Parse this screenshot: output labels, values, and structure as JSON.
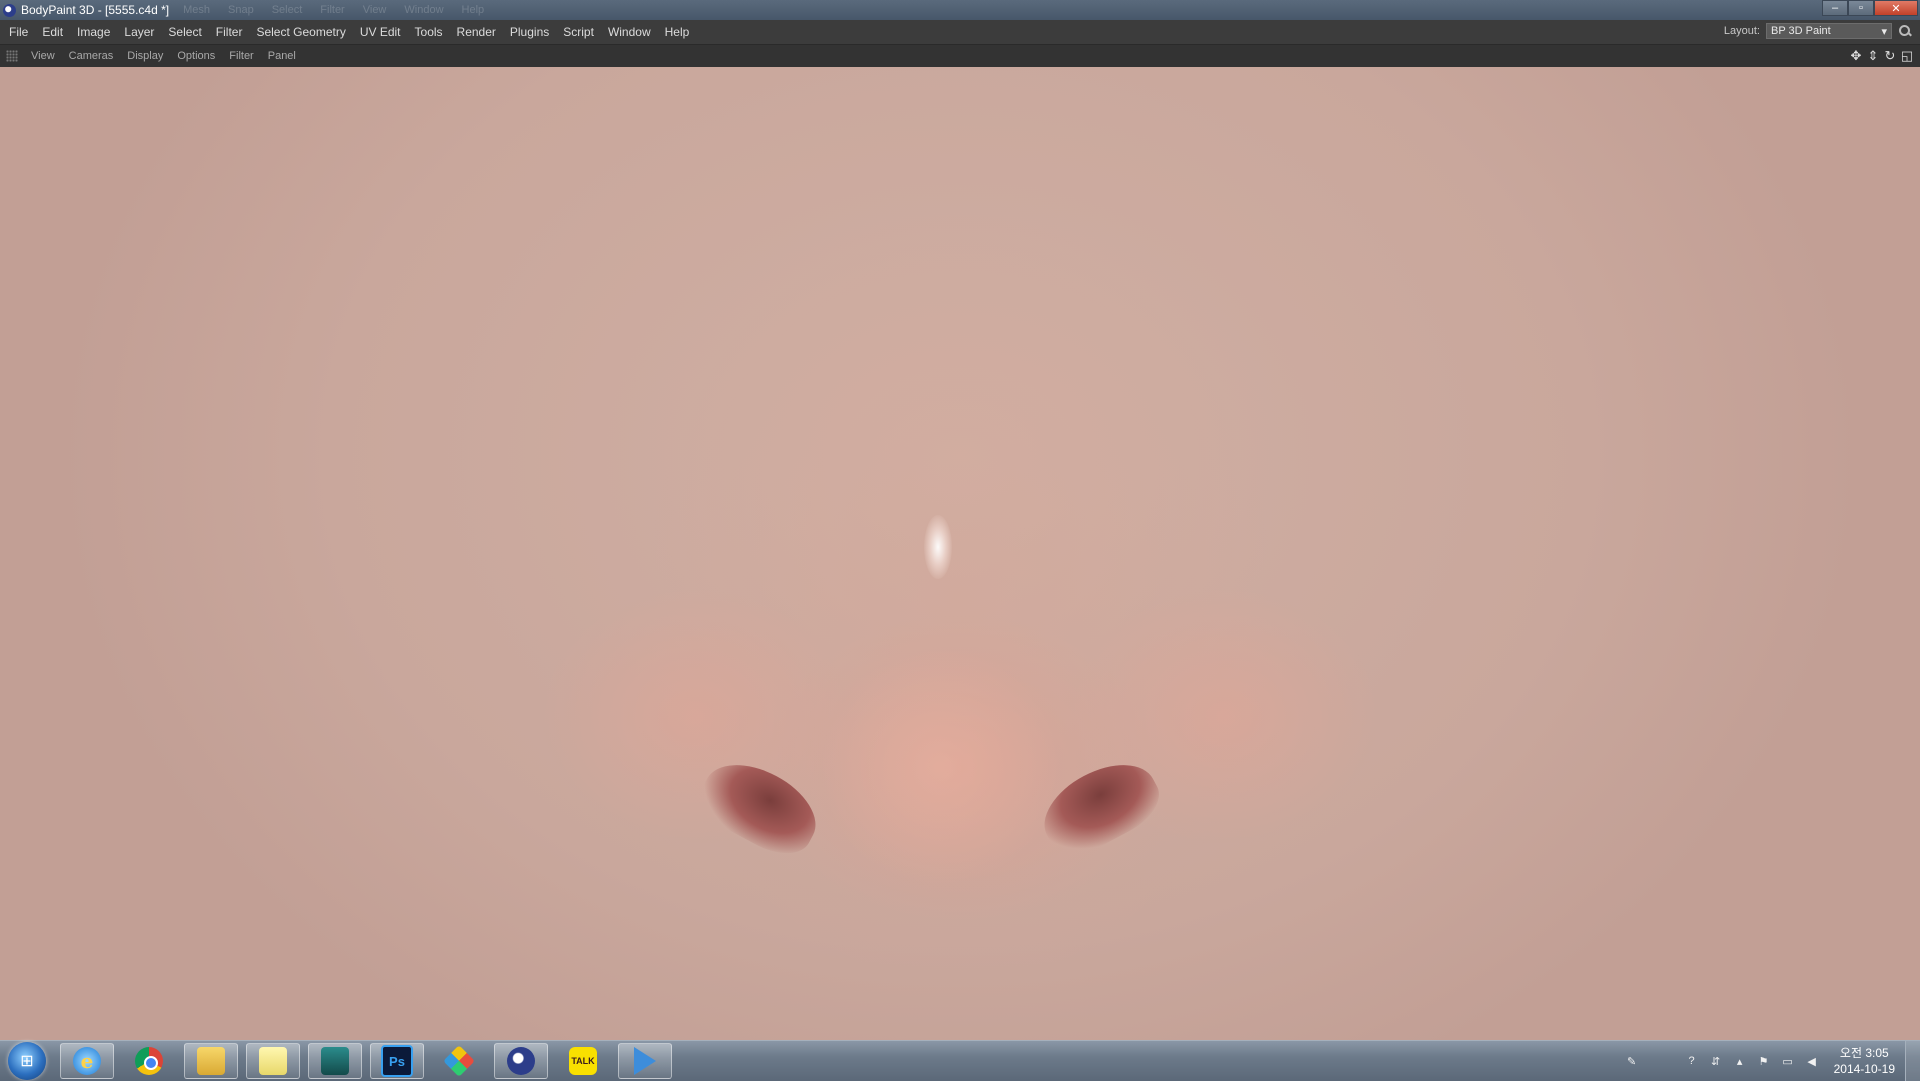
{
  "window": {
    "title": "BodyPaint 3D - [5555.c4d *]",
    "ghost_menu": [
      "Mesh",
      "Snap",
      "Select",
      "Filter",
      "View",
      "Window",
      "Help"
    ],
    "controls": {
      "minimize": "–",
      "maximize": "▫",
      "close": "✕"
    }
  },
  "menubar": {
    "items": [
      "File",
      "Edit",
      "Image",
      "Layer",
      "Select",
      "Filter",
      "Select Geometry",
      "UV Edit",
      "Tools",
      "Render",
      "Plugins",
      "Script",
      "Window",
      "Help"
    ],
    "layout_label": "Layout:",
    "layout_value": "BP 3D Paint"
  },
  "viewport_bar": {
    "items": [
      "View",
      "Cameras",
      "Display",
      "Options",
      "Filter",
      "Panel"
    ],
    "nav_icons": [
      "move-icon",
      "zoom-icon",
      "rotate-icon",
      "maximize-view-icon"
    ]
  },
  "taskbar": {
    "apps": [
      {
        "name": "internet-explorer",
        "label": "e"
      },
      {
        "name": "chrome",
        "label": ""
      },
      {
        "name": "file-explorer",
        "label": ""
      },
      {
        "name": "sticky-notes",
        "label": ""
      },
      {
        "name": "maya",
        "label": ""
      },
      {
        "name": "photoshop",
        "label": "Ps"
      },
      {
        "name": "tiles-app",
        "label": ""
      },
      {
        "name": "cinema4d",
        "label": ""
      },
      {
        "name": "kakaotalk",
        "label": "TALK"
      },
      {
        "name": "media-player",
        "label": ""
      }
    ],
    "clock_time": "오전 3:05",
    "clock_date": "2014-10-19"
  }
}
